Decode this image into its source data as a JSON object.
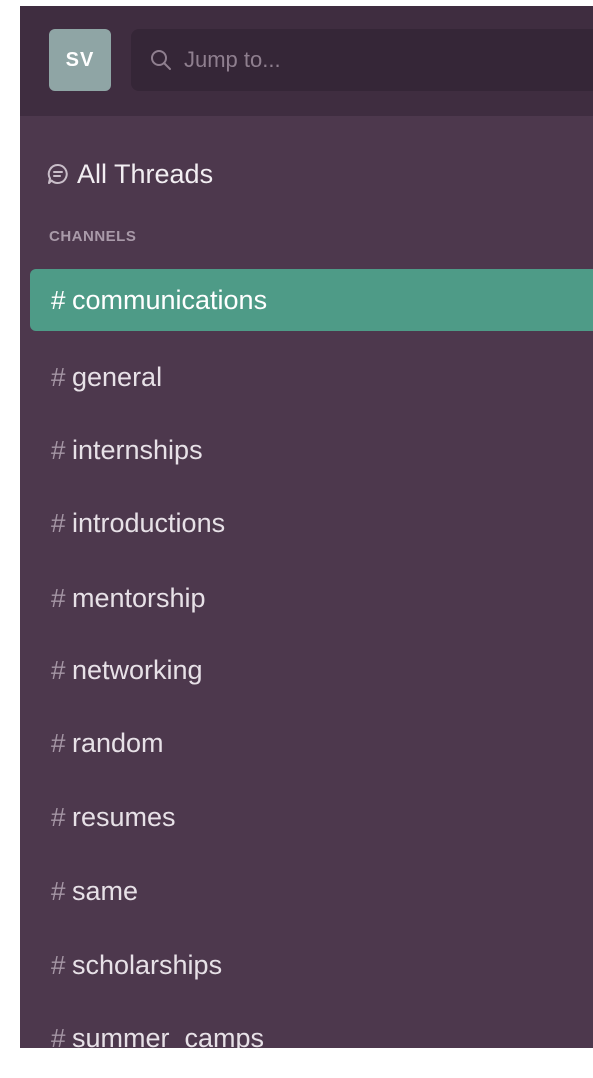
{
  "workspace": {
    "avatar_initials": "SV",
    "avatar_color": "#8fa5a5"
  },
  "search": {
    "placeholder": "Jump to...",
    "icon": "search-icon"
  },
  "all_threads": {
    "label": "All Threads",
    "icon": "threads-icon"
  },
  "channels": {
    "header": "CHANNELS",
    "items": [
      {
        "hash": "#",
        "name": "communications",
        "active": true
      },
      {
        "hash": "#",
        "name": "general"
      },
      {
        "hash": "#",
        "name": "internships"
      },
      {
        "hash": "#",
        "name": "introductions"
      },
      {
        "hash": "#",
        "name": "mentorship"
      },
      {
        "hash": "#",
        "name": "networking"
      },
      {
        "hash": "#",
        "name": "random"
      },
      {
        "hash": "#",
        "name": "resumes"
      },
      {
        "hash": "#",
        "name": "same"
      },
      {
        "hash": "#",
        "name": "scholarships"
      },
      {
        "hash": "#",
        "name": "summer_camps"
      }
    ]
  },
  "colors": {
    "sidebar_bg": "#4d384d",
    "topbar_bg": "#3f2d40",
    "active_channel": "#4e9b87"
  }
}
